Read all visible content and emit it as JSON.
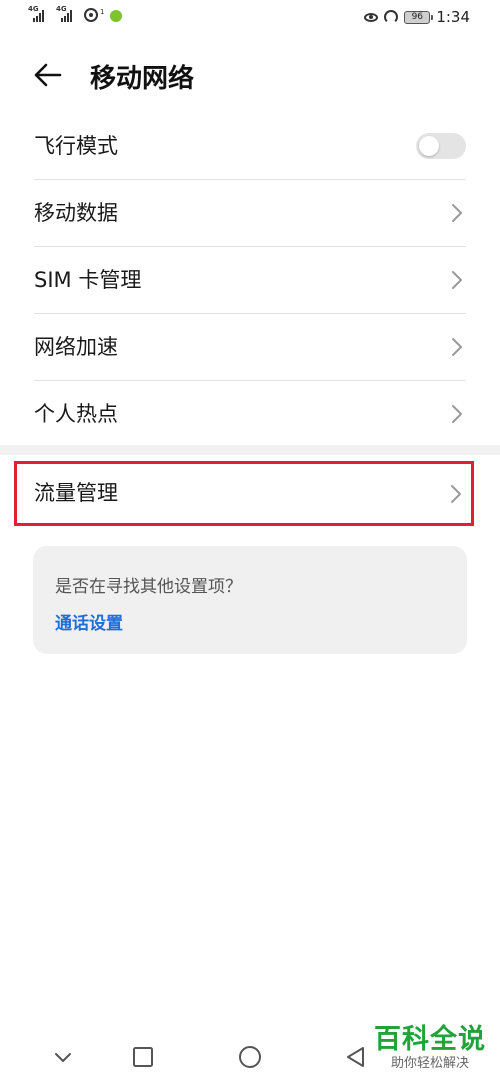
{
  "status_bar": {
    "sim1_label": "4G",
    "sim2_label": "4G",
    "hotspot_count": "1",
    "battery": "96",
    "time": "1:34"
  },
  "header": {
    "title": "移动网络",
    "back_icon": "arrow-left-icon"
  },
  "settings": {
    "items": [
      {
        "label": "飞行模式",
        "control": "toggle",
        "on": false
      },
      {
        "label": "移动数据",
        "control": "chevron"
      },
      {
        "label": "SIM 卡管理",
        "control": "chevron"
      },
      {
        "label": "网络加速",
        "control": "chevron"
      },
      {
        "label": "个人热点",
        "control": "chevron"
      }
    ],
    "data_management": {
      "label": "流量管理",
      "highlight_color": "#e02030"
    }
  },
  "suggestion": {
    "question": "是否在寻找其他设置项？",
    "link": "通话设置",
    "link_color": "#1e6fd9"
  },
  "watermark": {
    "title": "百科全说",
    "subtitle": "助你轻松解决",
    "color": "#22a33a"
  }
}
